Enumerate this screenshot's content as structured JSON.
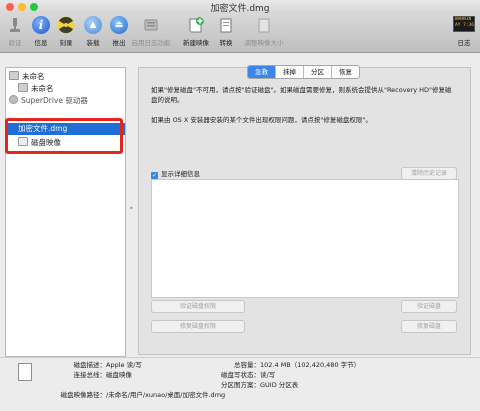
{
  "window": {
    "title": "加密文件.dmg"
  },
  "toolbar": {
    "items": [
      {
        "label": "验证",
        "icon": "microscope-icon",
        "enabled": false
      },
      {
        "label": "信息",
        "icon": "info-icon",
        "enabled": true
      },
      {
        "label": "刻录",
        "icon": "burn-icon",
        "enabled": true
      },
      {
        "label": "装载",
        "icon": "mount-icon",
        "enabled": true
      },
      {
        "label": "推出",
        "icon": "eject-icon",
        "enabled": true
      },
      {
        "label": "启用日志功能",
        "icon": "journal-icon",
        "enabled": false
      },
      {
        "label": "新建映像",
        "icon": "new-image-icon",
        "enabled": true
      },
      {
        "label": "转换",
        "icon": "convert-icon",
        "enabled": true
      },
      {
        "label": "调整映像大小",
        "icon": "resize-image-icon",
        "enabled": false
      }
    ],
    "log": {
      "label": "日志",
      "screen_text": "WARNIN\nAY 7:36"
    }
  },
  "sidebar": {
    "items": [
      {
        "label": "未命名",
        "indent": 0,
        "selected": false
      },
      {
        "label": "未命名",
        "indent": 1,
        "selected": false
      },
      {
        "label": "SuperDrive 驱动器",
        "indent": 0,
        "selected": false
      },
      {
        "label": "加密文件.dmg",
        "indent": 0,
        "selected": true
      },
      {
        "label": "磁盘映像",
        "indent": 1,
        "selected": false
      }
    ]
  },
  "tabs": [
    "急救",
    "抹掉",
    "分区",
    "恢复"
  ],
  "active_tab": 0,
  "firstaid": {
    "para1": "如果\"修复磁盘\"不可用，请点按\"验证磁盘\"。如果磁盘需要修复，则系统会提供从\"Recovery HD\"修复磁盘的说明。",
    "para2": "如果由 OS X 安装器安装的某个文件出现权限问题，请点按\"修复磁盘权限\"。",
    "show_details": "显示详细信息",
    "clear_history": "清除历史记录",
    "verify_permissions": "验证磁盘权限",
    "repair_permissions": "修复磁盘权限",
    "verify_disk": "验证磁盘",
    "repair_disk": "修复磁盘"
  },
  "info": {
    "left": [
      {
        "key": "磁盘描述：",
        "value": "Apple 读/写"
      },
      {
        "key": "连接总线：",
        "value": "磁盘映像"
      }
    ],
    "right": [
      {
        "key": "总容量：",
        "value": "102.4 MB（102,420,480 字节）"
      },
      {
        "key": "磁盘写状态：",
        "value": "读/写"
      },
      {
        "key": "分区图方案：",
        "value": "GUID 分区表"
      }
    ],
    "path_key": "磁盘映像路径：",
    "path_value": "/未命名/用户/xunao/桌面/加密文件.dmg"
  },
  "colors": {
    "accent": "#1e6ed6",
    "highlight_box": "#e0261e"
  }
}
